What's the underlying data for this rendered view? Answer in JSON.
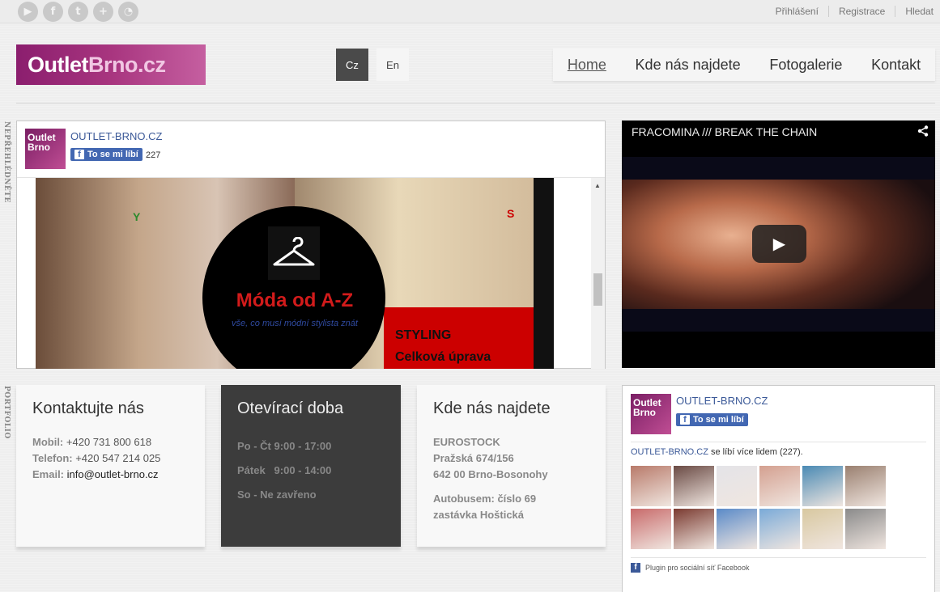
{
  "topbar": {
    "social_icons": [
      "youtube-icon",
      "facebook-icon",
      "twitter-icon",
      "google-plus-icon",
      "rss-icon"
    ],
    "links": [
      "Přihlášení",
      "Registrace",
      "Hledat"
    ]
  },
  "header": {
    "logo_part1": "Outlet",
    "logo_part2": "Brno.cz",
    "lang_cz": "Cz",
    "lang_en": "En",
    "nav": [
      "Home",
      "Kde nás najdete",
      "Fotogalerie",
      "Kontakt"
    ],
    "active_nav": "Home"
  },
  "side_labels": {
    "top": "NEPŘEHLÉDNĚTE",
    "bottom": "PORTFOLIO"
  },
  "fb_page": {
    "thumb_line1": "Outlet",
    "thumb_line2": "Brno",
    "name": "OUTLET-BRNO.CZ",
    "like_label": "To se mi líbí",
    "like_count": "227"
  },
  "promo": {
    "title": "Móda od A-Z",
    "subtitle": "vše, co musí módní stylista znát",
    "styling": "STYLING",
    "celkova": "Celková úprava",
    "letter_y": "Y",
    "letter_s": "S"
  },
  "video": {
    "title": "FRACOMINA /// BREAK THE CHAIN"
  },
  "contact": {
    "heading": "Kontaktujte nás",
    "rows": [
      {
        "label": "Mobil:",
        "value": "+420 731 800 618"
      },
      {
        "label": "Telefon:",
        "value": "+420 547 214 025"
      },
      {
        "label": "Email:",
        "value": "info@outlet-brno.cz"
      }
    ]
  },
  "hours": {
    "heading": "Otevírací doba",
    "rows": [
      "Po - Čt 9:00 - 17:00",
      "Pátek   9:00 - 14:00",
      "So - Ne zavřeno"
    ]
  },
  "location": {
    "heading": "Kde nás najdete",
    "lines": [
      "EUROSTOCK",
      "Pražská 674/156",
      "642 00 Brno-Bosonohy"
    ],
    "bus_lines": [
      "Autobusem: číslo 69",
      "zastávka Hoštická"
    ]
  },
  "fb_likebox": {
    "thumb_line1": "Outlet",
    "thumb_line2": "Brno",
    "name": "OUTLET-BRNO.CZ",
    "like_label": "To se mi líbí",
    "likes_page": "OUTLET-BRNO.CZ",
    "likes_text": " se líbí více lidem (227).",
    "face_colors": [
      "#b87a6a",
      "#6a4a44",
      "#e4e4e8",
      "#d4a090",
      "#4a8ab4",
      "#9a8070",
      "#c86a6a",
      "#7a3a30",
      "#5a8ac8",
      "#7aaad8",
      "#d8c8a0",
      "#8a8a8a"
    ],
    "plugin_label": "Plugin pro sociální síť Facebook"
  }
}
